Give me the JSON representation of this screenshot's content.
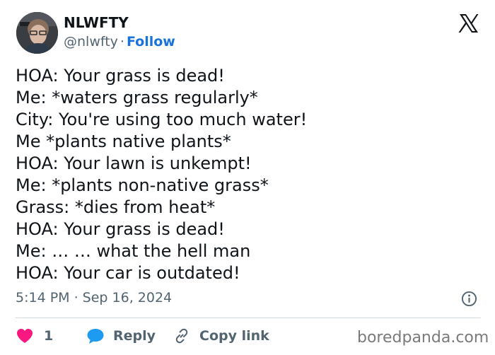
{
  "author": {
    "display_name": "NLWFTY",
    "handle": "@nlwfty",
    "separator": "·",
    "follow_label": "Follow"
  },
  "tweet": {
    "lines": [
      "HOA: Your grass is dead!",
      "Me: *waters grass regularly*",
      "City: You're using too much water!",
      "Me *plants native plants*",
      "HOA: Your lawn is unkempt!",
      "Me: *plants non-native grass*",
      "Grass: *dies from heat*",
      "HOA: Your grass is dead!",
      "Me: … … what the hell man",
      "HOA: Your car is outdated!"
    ],
    "timestamp": "5:14 PM · Sep 16, 2024"
  },
  "actions": {
    "like_count": "1",
    "reply_label": "Reply",
    "copy_link_label": "Copy link"
  },
  "watermark": "boredpanda.com",
  "icons": {
    "logo": "x-logo-icon",
    "info": "info-icon",
    "like": "heart-icon",
    "reply": "reply-bubble-icon",
    "copy": "link-icon"
  },
  "colors": {
    "follow": "#1a73d9",
    "heart": "#f91880",
    "reply_bubble": "#1d9bf0",
    "secondary_text": "#536471",
    "divider": "#cfd9de"
  }
}
